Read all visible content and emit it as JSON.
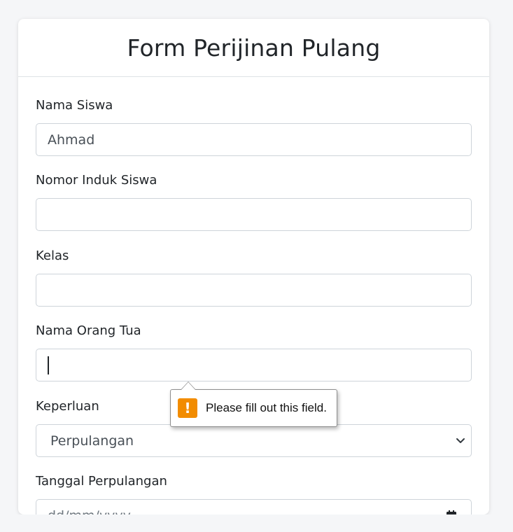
{
  "form": {
    "title": "Form Perijinan Pulang",
    "fields": [
      {
        "label": "Nama Siswa",
        "value": "Ahmad"
      },
      {
        "label": "Nomor Induk Siswa",
        "value": ""
      },
      {
        "label": "Kelas",
        "value": ""
      },
      {
        "label": "Nama Orang Tua",
        "value": ""
      },
      {
        "label": "Keperluan",
        "value": "Perpulangan"
      },
      {
        "label": "Tanggal Perpulangan",
        "value": "dd/mm/yyyy"
      }
    ]
  },
  "validation_tooltip": {
    "message": "Please fill out this field.",
    "icon": "warning-icon",
    "icon_glyph": "!",
    "icon_color": "#f28c00"
  }
}
